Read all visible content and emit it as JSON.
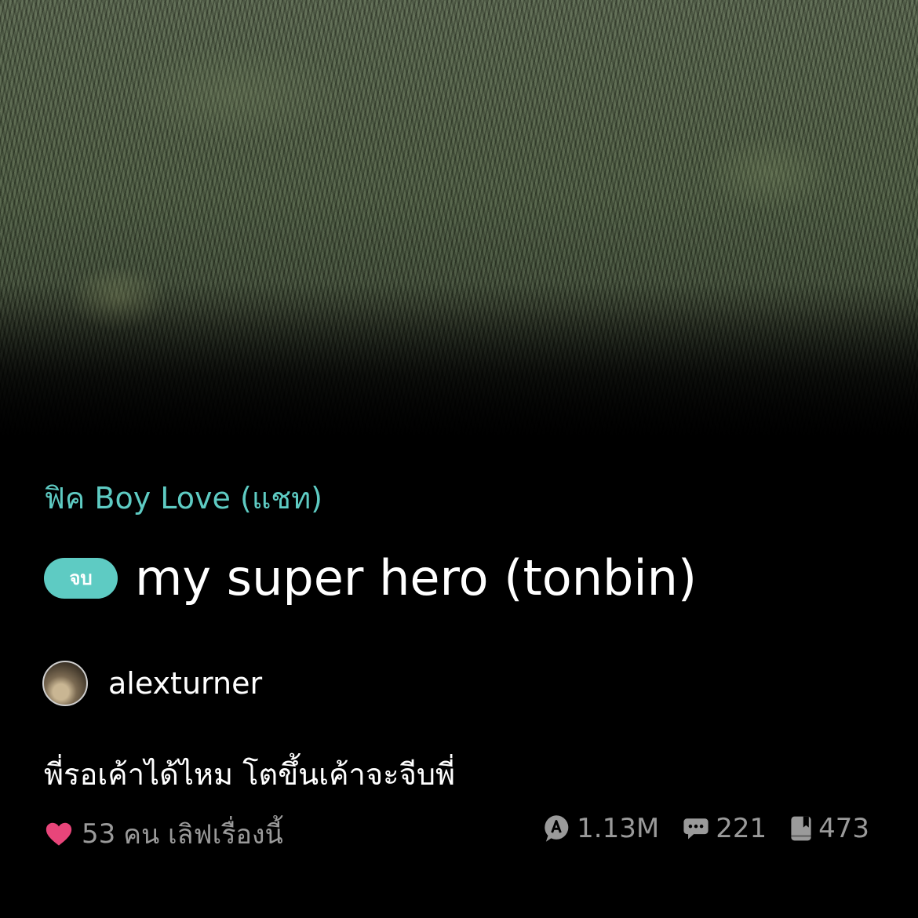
{
  "story": {
    "category": "ฟิค Boy Love (แชท)",
    "status_badge": "จบ",
    "title": "my super hero (tonbin)",
    "author": "alexturner",
    "blurb": "พี่รอเค้าได้ไหม โตขึ้นเค้าจะจีบพี่"
  },
  "stats": {
    "love_count": "53",
    "love_label": "คน เลิฟเรื่องนี้",
    "views": "1.13M",
    "comments": "221",
    "chapters": "473"
  },
  "icons": {
    "love": "heart-icon",
    "views": "reader-bubble-icon",
    "comments": "comment-icon",
    "chapters": "book-icon"
  },
  "colors": {
    "accent": "#5ecbc3",
    "heart": "#e8457a",
    "muted": "#9a9a9a",
    "background": "#000000"
  }
}
